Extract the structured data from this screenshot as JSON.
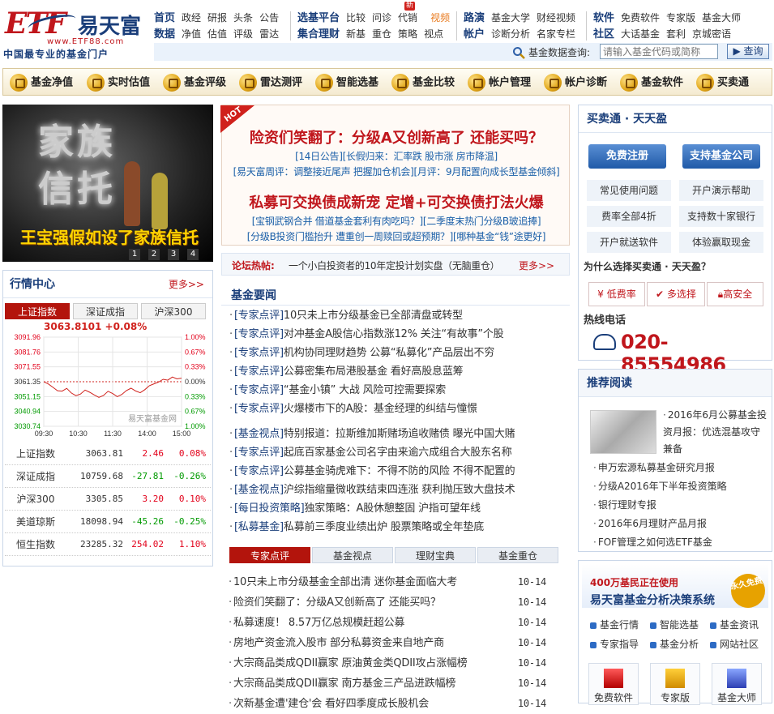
{
  "header": {
    "logo_text": "ETF",
    "logo_cn": "易天富",
    "logo_url": "www.ETF88.com",
    "slogan": "中国最专业的基金门户",
    "nav_groups": [
      {
        "rows": [
          [
            "首页",
            "政经",
            "研报",
            "头条",
            "公告"
          ],
          [
            "数据",
            "净值",
            "估值",
            "评级",
            "雷达"
          ]
        ]
      },
      {
        "rows": [
          [
            "选基平台",
            "比较",
            "问诊",
            "代销",
            "视频"
          ],
          [
            "集合理财",
            "新基",
            "重仓",
            "策略",
            "视点"
          ]
        ]
      },
      {
        "rows": [
          [
            "路演",
            "基金大学",
            "财经视频"
          ],
          [
            "帐户",
            "诊断分析",
            "名家专栏"
          ]
        ]
      },
      {
        "rows": [
          [
            "软件",
            "免费软件",
            "专家版",
            "基金大师"
          ],
          [
            "社区",
            "大话基金",
            "套利",
            "京城密语"
          ]
        ]
      }
    ],
    "new_badge": "新",
    "search_label": "基金数据查询:",
    "search_placeholder": "请输入基金代码或简称",
    "search_button": "查询"
  },
  "toolbar": [
    "基金净值",
    "实时估值",
    "基金评级",
    "雷达测评",
    "智能选基",
    "基金比较",
    "帐户管理",
    "帐户诊断",
    "基金软件",
    "买卖通"
  ],
  "banner": {
    "big_text": "家族信托",
    "caption": "王宝强假如设了家族信托",
    "pages": [
      "1",
      "2",
      "3",
      "4"
    ]
  },
  "market": {
    "title": "行情中心",
    "more": "更多>>",
    "tabs": [
      "上证指数",
      "深证成指",
      "沪深300"
    ],
    "chart_watermark": "易天富基金网",
    "quotes": [
      {
        "name": "上证指数",
        "value": "3063.81",
        "change": "2.46",
        "pct": "0.08%",
        "dir": "up"
      },
      {
        "name": "深证成指",
        "value": "10759.68",
        "change": "-27.81",
        "pct": "-0.26%",
        "dir": "dn"
      },
      {
        "name": "沪深300",
        "value": "3305.85",
        "change": "3.20",
        "pct": "0.10%",
        "dir": "up"
      },
      {
        "name": "美道琼斯",
        "value": "18098.94",
        "change": "-45.26",
        "pct": "-0.25%",
        "dir": "dn"
      },
      {
        "name": "恒生指数",
        "value": "23285.32",
        "change": "254.02",
        "pct": "1.10%",
        "dir": "up"
      }
    ]
  },
  "chart_data": {
    "type": "line",
    "title": "3063.8101 +0.08%",
    "x_ticks": [
      "09:30",
      "10:30",
      "11:30",
      "14:00",
      "15:00"
    ],
    "y_ticks": [
      "3091.96",
      "3081.76",
      "3071.55",
      "3061.35",
      "3051.15",
      "3040.94",
      "3030.74"
    ],
    "y_pct_ticks": [
      "1.00%",
      "0.67%",
      "0.33%",
      "0.00%",
      "0.33%",
      "0.67%",
      "1.00%"
    ],
    "ylim": [
      3030.74,
      3091.96
    ],
    "base": 3061.35,
    "series": [
      {
        "values": [
          3061.3,
          3059.8,
          3057.5,
          3055.2,
          3054.9,
          3056.8,
          3053.6,
          3051.8,
          3052.9,
          3055.6,
          3054.1,
          3052.3,
          3050.6,
          3051.9,
          3054.8,
          3053.2,
          3051.1,
          3052.6,
          3055.3,
          3056.9,
          3055.0,
          3053.8,
          3055.9,
          3058.6,
          3059.9,
          3061.1,
          3063.0,
          3062.4,
          3064.6,
          3063.3,
          3063.8
        ]
      }
    ]
  },
  "headlines": {
    "hot": "HOT",
    "h1": "险资们笑翻了：分级A又创新高了 还能买吗？",
    "sub1": "[14日公告][长假归来：汇率跌 股市涨 房市降温]",
    "sub2": "[易天富周评：调整接近尾声 把握加仓机会][月评：9月配置向成长型基金倾斜]",
    "h2": "私募可交换债成新宠 定增+可交换债打法火爆",
    "sub3": "[宝钢武钢合并 借道基金套利有肉吃吗？][二季度末热门分级B玻追捧]",
    "sub4": "[分级B投资门槛抬升 遭重创一周赎回或超预期？][哪种基金“钱”途更好]"
  },
  "forum": {
    "label": "论坛热帖:",
    "text": "一个小白投资者的10年定投计划实盘（无脑重仓）",
    "more": "更多>>"
  },
  "news": {
    "title": "基金要闻",
    "group1": [
      {
        "tag": "[专家点评]",
        "text": "10只未上市分级基金已全部清盘或转型"
      },
      {
        "tag": "[专家点评]",
        "text": "对冲基金A股信心指数涨12% 关注“有故事”个股"
      },
      {
        "tag": "[专家点评]",
        "text": "机构协同理财趋势 公募“私募化”产品层出不穷"
      },
      {
        "tag": "[专家点评]",
        "text": "公募密集布局港股基金 看好高股息蓝筹"
      },
      {
        "tag": "[专家点评]",
        "text": "“基金小镇” 大战 风险可控需要探索"
      },
      {
        "tag": "[专家点评]",
        "text": "火爆楼市下的A股：基金经理的纠结与憧憬"
      }
    ],
    "group2": [
      {
        "tag": "[基金视点]",
        "text": "特别报道：拉斯维加斯赌场追收赌债 曝光中国大赌"
      },
      {
        "tag": "[专家点评]",
        "text": "起底百家基金公司名字由来逾六成组合大股东名称"
      },
      {
        "tag": "[专家点评]",
        "text": "公募基金骑虎难下：不得不防的风险 不得不配置的"
      },
      {
        "tag": "[基金视点]",
        "text": "沪综指缩量微收跌结束四连涨 获利抛压致大盘技术"
      },
      {
        "tag": "[每日投资策略]",
        "text": "独家策略：A股休憩整固 沪指可望年线"
      },
      {
        "tag": "[私募基金]",
        "text": "私募前三季度业绩出炉 股票策略或全年垫底"
      }
    ]
  },
  "news_tabs": [
    "专家点评",
    "基金视点",
    "理财宝典",
    "基金重仓"
  ],
  "dated_list": [
    {
      "text": "10只未上市分级基金全部出清 迷你基金面临大考",
      "date": "10-14"
    },
    {
      "text": "险资们笑翻了：分级A又创新高了 还能买吗？",
      "date": "10-14"
    },
    {
      "text": "私募速度！ 8.57万亿总规模赶超公募",
      "date": "10-14"
    },
    {
      "text": "房地产资金流入股市 部分私募资金来自地产商",
      "date": "10-14"
    },
    {
      "text": "大宗商品类成QDII赢家 原油黄金类QDII攻占涨幅榜",
      "date": "10-14"
    },
    {
      "text": "大宗商品类成QDII赢家 南方基金三产品进跌幅榜",
      "date": "10-14"
    },
    {
      "text": "次新基金遭'建仓'会 看好四季度成长股机会",
      "date": "10-14"
    }
  ],
  "buy": {
    "title": "买卖通 · 天天盈",
    "register": "免费注册",
    "supported": "支持基金公司",
    "faq": [
      "常见使用问题",
      "开户演示帮助",
      "费率全部4折",
      "支持数十家银行",
      "开户就送软件",
      "体验赢取现金"
    ],
    "why": "为什么选择买卖通 · 天天盈？",
    "features": [
      "低费率",
      "多选择",
      "高安全"
    ],
    "hotline_label": "热线电话",
    "hotline": "020-85554986"
  },
  "read": {
    "title": "推荐阅读",
    "featured": "2016年6月公募基金投资月报：优选混基攻守兼备",
    "items": [
      "申万宏源私募基金研究月报",
      "分级A2016年下半年投资策略",
      "银行理财专报",
      "2016年6月理财产品月报",
      "FOF管理之如何选ETF基金"
    ]
  },
  "ad": {
    "line1": "400万基民正在使用",
    "line2": "易天富基金分析决策系统",
    "stamp": "永久免费",
    "links": [
      "基金行情",
      "智能选基",
      "基金资讯",
      "专家指导",
      "基金分析",
      "网站社区"
    ],
    "boxes": [
      "免费软件",
      "专家版",
      "基金大师"
    ]
  }
}
